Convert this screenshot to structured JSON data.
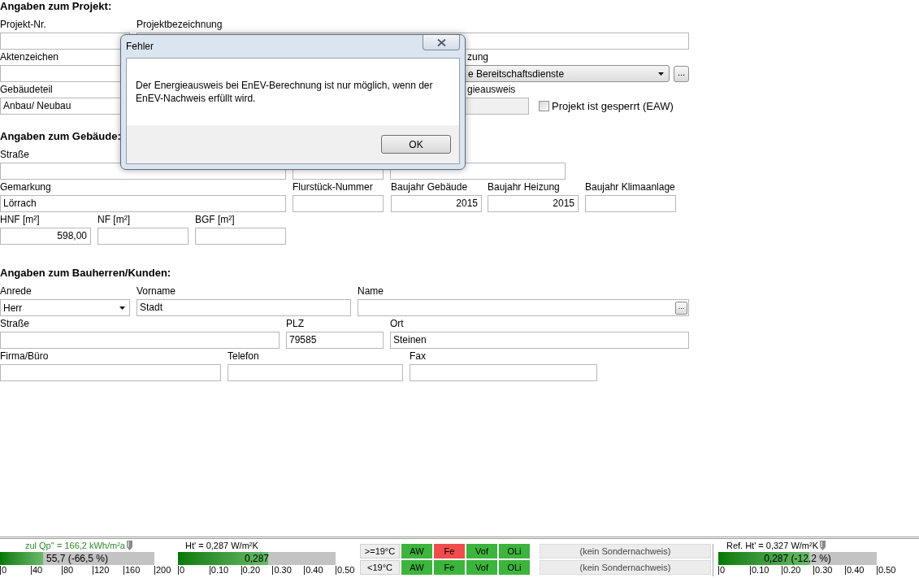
{
  "sections": [
    {
      "heading": "Angaben zum Projekt:",
      "rows": [
        {
          "fields": [
            {
              "kind": "text",
              "label": "Projekt-Nr.",
              "disabled": false
            },
            {
              "kind": "text",
              "label": "Projektbezeichnung",
              "disabled": false
            }
          ]
        },
        {
          "fields": [
            {
              "kind": "text",
              "label": "Aktenzeichen",
              "disabled": false
            },
            {
              "kind": "dropdown",
              "label": "zung",
              "value": "e Bereitschaftsdienste",
              "button": "...",
              "disabled": false
            }
          ]
        },
        {
          "fields": [
            {
              "kind": "text",
              "label": "Gebäudeteil",
              "value": "Anbau/ Neubau",
              "disabled": false
            },
            {
              "kind": "text",
              "label": "gieausweis",
              "disabled": true
            },
            {
              "kind": "checkbox",
              "label": "Projekt ist gesperrt (EAW)",
              "checked": false
            }
          ]
        }
      ]
    },
    {
      "heading": "Angaben zum Gebäude:",
      "rows": [
        {
          "fields": [
            {
              "kind": "text",
              "label": "Straße",
              "disabled": false
            },
            {
              "kind": "text",
              "disabled": false
            },
            {
              "kind": "text",
              "disabled": false
            }
          ]
        },
        {
          "fields": [
            {
              "kind": "text",
              "label": "Gemarkung",
              "value": "Lörrach",
              "disabled": false
            },
            {
              "kind": "text",
              "label": "Flurstück-Nummer",
              "disabled": false
            },
            {
              "kind": "number",
              "label": "Baujahr Gebäude",
              "value": "2015",
              "disabled": false
            },
            {
              "kind": "number",
              "label": "Baujahr Heizung",
              "value": "2015",
              "disabled": false
            },
            {
              "kind": "text",
              "label": "Baujahr Klimaanlage",
              "disabled": false
            }
          ]
        },
        {
          "fields": [
            {
              "kind": "number",
              "label": "HNF [m²]",
              "value": "598,00",
              "disabled": false
            },
            {
              "kind": "number",
              "label": "NF [m²]",
              "disabled": false
            },
            {
              "kind": "number",
              "label": "BGF [m²]",
              "disabled": false
            }
          ]
        }
      ]
    },
    {
      "heading": "Angaben zum Bauherren/Kunden:",
      "rows": [
        {
          "fields": [
            {
              "kind": "combo",
              "label": "Anrede",
              "value": "Herr",
              "disabled": false
            },
            {
              "kind": "text",
              "label": "Vorname",
              "value": "Stadt",
              "disabled": false
            },
            {
              "kind": "lookup",
              "label": "Name",
              "button": "...",
              "disabled": false
            }
          ]
        },
        {
          "fields": [
            {
              "kind": "text",
              "label": "Straße",
              "disabled": false
            },
            {
              "kind": "text",
              "label": "PLZ",
              "value": "79585",
              "disabled": false
            },
            {
              "kind": "text",
              "label": "Ort",
              "value": "Steinen",
              "disabled": false
            }
          ]
        },
        {
          "fields": [
            {
              "kind": "text",
              "label": "Firma/Büro",
              "disabled": false
            },
            {
              "kind": "text",
              "label": "Telefon",
              "disabled": false
            },
            {
              "kind": "text",
              "label": "Fax",
              "disabled": false
            }
          ]
        }
      ]
    }
  ],
  "dialog": {
    "title": "Fehler",
    "message": "Der Energieausweis bei EnEV-Berechnung ist nur möglich, wenn der EnEV-Nachweis erfüllt wird.",
    "buttons": [
      "OK"
    ]
  },
  "status_bar": {
    "gauges": [
      {
        "caption": "zul Qp'' = 166,2 kWh/m²a",
        "color": "#2a8a2a",
        "marker": true,
        "level": 0.2785,
        "reading": "55,7 (-66,5 %)",
        "ticks": [
          "0",
          "40",
          "80",
          "120",
          "160",
          "200"
        ]
      },
      {
        "caption": "Ht' = 0,287 W/m²K",
        "color": "#000000",
        "marker": false,
        "level": 0.574,
        "reading": "0,287",
        "ticks": [
          "0",
          "0.10",
          "0.20",
          "0.30",
          "0.40",
          "0.50"
        ]
      }
    ],
    "temperature_rows": [
      {
        "label": ">=19°C",
        "cells": [
          {
            "label": "AW",
            "color": "#3bb53b"
          },
          {
            "label": "Fe",
            "color": "#f24b4b"
          },
          {
            "label": "Vof",
            "color": "#3bb53b"
          },
          {
            "label": "OLi",
            "color": "#3bb53b"
          }
        ]
      },
      {
        "label": "<19°C",
        "cells": [
          {
            "label": "AW",
            "color": "#3bb53b"
          },
          {
            "label": "Fe",
            "color": "#3bb53b"
          },
          {
            "label": "Vof",
            "color": "#3bb53b"
          },
          {
            "label": "OLi",
            "color": "#3bb53b"
          }
        ]
      }
    ],
    "special_proofs": [
      "(kein Sondernachweis)",
      "(kein Sondernachweis)"
    ],
    "reference_gauge": {
      "caption": "Ref. Ht' = 0,327 W/m²K",
      "color": "#000000",
      "marker": true,
      "level": 0.574,
      "reading": "0,287 (-12,2 %)",
      "ticks": [
        "0",
        "0.10",
        "0.20",
        "0.30",
        "0.40",
        "0.50"
      ]
    }
  }
}
